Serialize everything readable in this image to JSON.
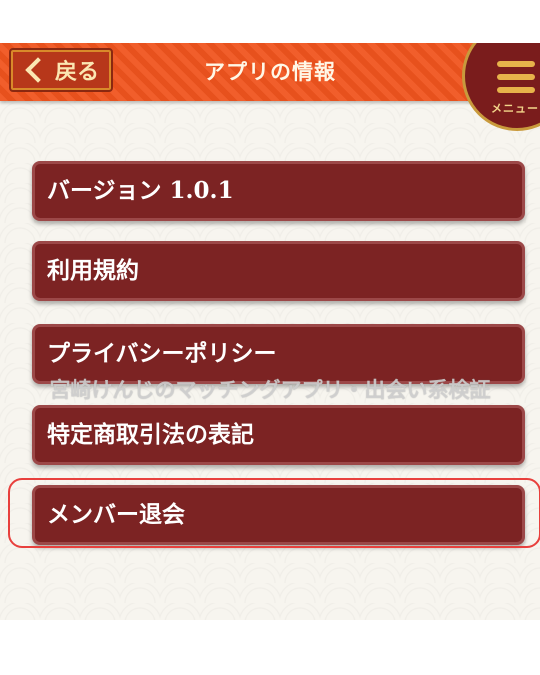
{
  "header": {
    "back_label": "戻る",
    "title": "アプリの情報",
    "menu_label": "メニュー"
  },
  "menu_items": [
    {
      "label": "バージョン 1.0.1"
    },
    {
      "label": "利用規約"
    },
    {
      "label": "プライバシーポリシー"
    },
    {
      "label": "特定商取引法の表記"
    },
    {
      "label": "メンバー退会"
    }
  ],
  "watermark": "宮崎けんじのマッチングアプリ・出会い系検証",
  "colors": {
    "header": "#f0541e",
    "item_bg": "#7c2323",
    "highlight": "#e8403d",
    "accent_gold": "#e7b34a"
  }
}
